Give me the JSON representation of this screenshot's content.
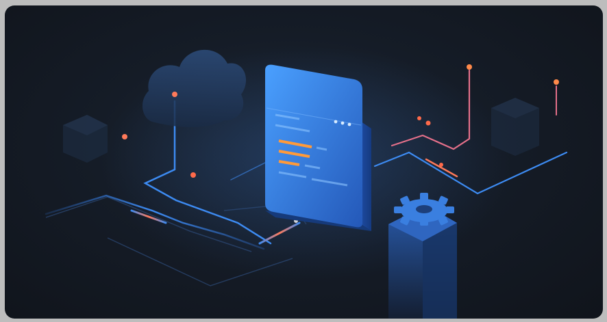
{
  "illustration": {
    "theme": "cloud-infrastructure",
    "colors": {
      "background": "#141a23",
      "primary_blue": "#3d8bf2",
      "panel_blue": "#2f6fd0",
      "accent_orange": "#ff7a3d",
      "glow_pink": "#ff5a9a",
      "frame_grey": "#bdbdbd"
    },
    "icons": [
      "cloud-icon",
      "browser-window-icon",
      "gear-icon",
      "server-cube-icon",
      "circuit-line-icon",
      "signal-pin-icon"
    ]
  }
}
